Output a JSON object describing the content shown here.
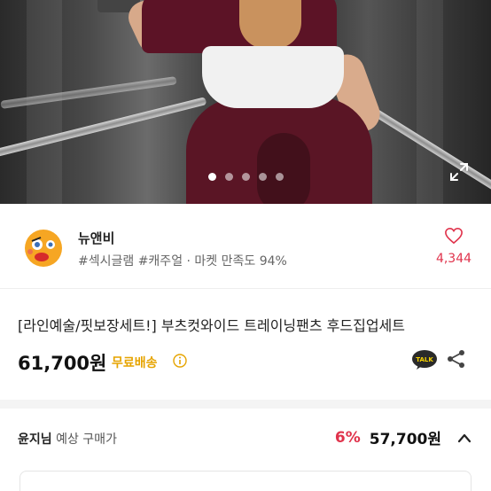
{
  "gallery": {
    "slide_count": 5,
    "active_index": 0
  },
  "seller": {
    "name": "뉴앤비",
    "tags": "#섹시글램 #캐주얼 · 마켓 만족도 94%",
    "likes": "4,344"
  },
  "product": {
    "title": "[라인예술/핏보장세트!] 부츠컷와이드 트레이닝팬츠 후드집업세트",
    "price": "61,700원",
    "shipping": "무료배송"
  },
  "coupon": {
    "user": "윤지님",
    "label": "예상 구매가",
    "discount": "6%",
    "price": "57,700원"
  },
  "colors": {
    "accent_red": "#e0334c",
    "shipping_yellow": "#e6a400",
    "talk_yellow": "#2a2a2a"
  },
  "icons": [
    "expand-icon",
    "heart-icon",
    "info-icon",
    "kakaotalk-icon",
    "share-icon",
    "chevron-up-icon"
  ]
}
